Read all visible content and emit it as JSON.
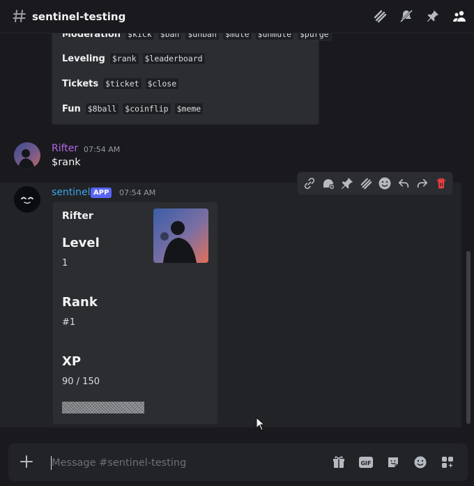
{
  "channel": {
    "name": "sentinel-testing"
  },
  "help_embed": {
    "rows": [
      {
        "category": "Moderation",
        "commands": [
          "$kick",
          "$ban",
          "$unban",
          "$mute",
          "$unmute",
          "$purge"
        ]
      },
      {
        "category": "Leveling",
        "commands": [
          "$rank",
          "$leaderboard"
        ]
      },
      {
        "category": "Tickets",
        "commands": [
          "$ticket",
          "$close"
        ]
      },
      {
        "category": "Fun",
        "commands": [
          "$8ball",
          "$coinflip",
          "$meme"
        ]
      }
    ]
  },
  "messages": [
    {
      "author": "Rifter",
      "author_color": "#b266e8",
      "time": "07:54 AM",
      "text": "$rank"
    },
    {
      "author": "sentinel",
      "author_color": "#3ea5e6",
      "badge": "APP",
      "time": "07:54 AM"
    }
  ],
  "rank_embed": {
    "user": "Rifter",
    "level_label": "Level",
    "level_value": "1",
    "rank_label": "Rank",
    "rank_value": "#1",
    "xp_label": "XP",
    "xp_value": "90 / 150",
    "xp_progress": 0.6
  },
  "composer": {
    "placeholder": "Message #sentinel-testing"
  },
  "icons": {
    "topbar": [
      "threads-icon",
      "mute-icon",
      "pin-icon",
      "members-icon"
    ],
    "toolbar": [
      "copy-link-icon",
      "add-app-icon",
      "pin-icon",
      "thread-icon",
      "add-reaction-icon",
      "reply-icon",
      "forward-icon",
      "delete-icon"
    ],
    "composer": [
      "gift-icon",
      "gif-icon",
      "sticker-icon",
      "emoji-icon",
      "apps-icon"
    ]
  }
}
